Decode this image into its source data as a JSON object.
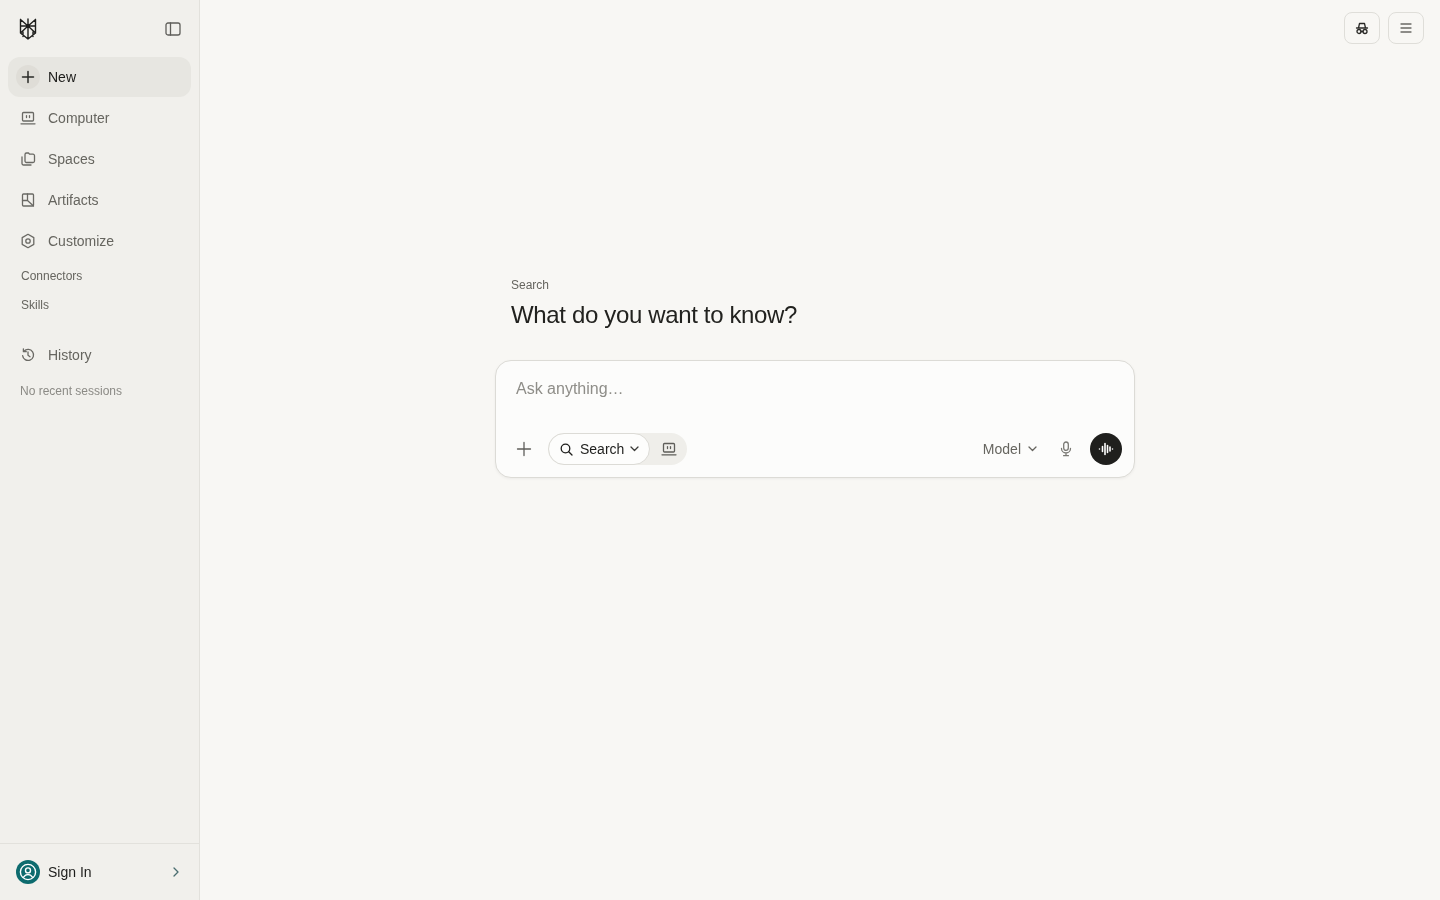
{
  "sidebar": {
    "nav": [
      {
        "label": "New",
        "selected": true
      },
      {
        "label": "Computer",
        "selected": false
      },
      {
        "label": "Spaces",
        "selected": false
      },
      {
        "label": "Artifacts",
        "selected": false
      },
      {
        "label": "Customize",
        "selected": false
      }
    ],
    "links": [
      "Connectors",
      "Skills"
    ],
    "history": {
      "label": "History",
      "empty_text": "No recent sessions"
    },
    "account": {
      "label": "Sign In"
    }
  },
  "main": {
    "eyebrow": "Search",
    "heading": "What do you want to know?",
    "composer": {
      "placeholder": "Ask anything…",
      "modes": [
        {
          "label": "Search",
          "selected": true
        },
        {
          "selected": false
        }
      ],
      "model": "Model"
    }
  }
}
